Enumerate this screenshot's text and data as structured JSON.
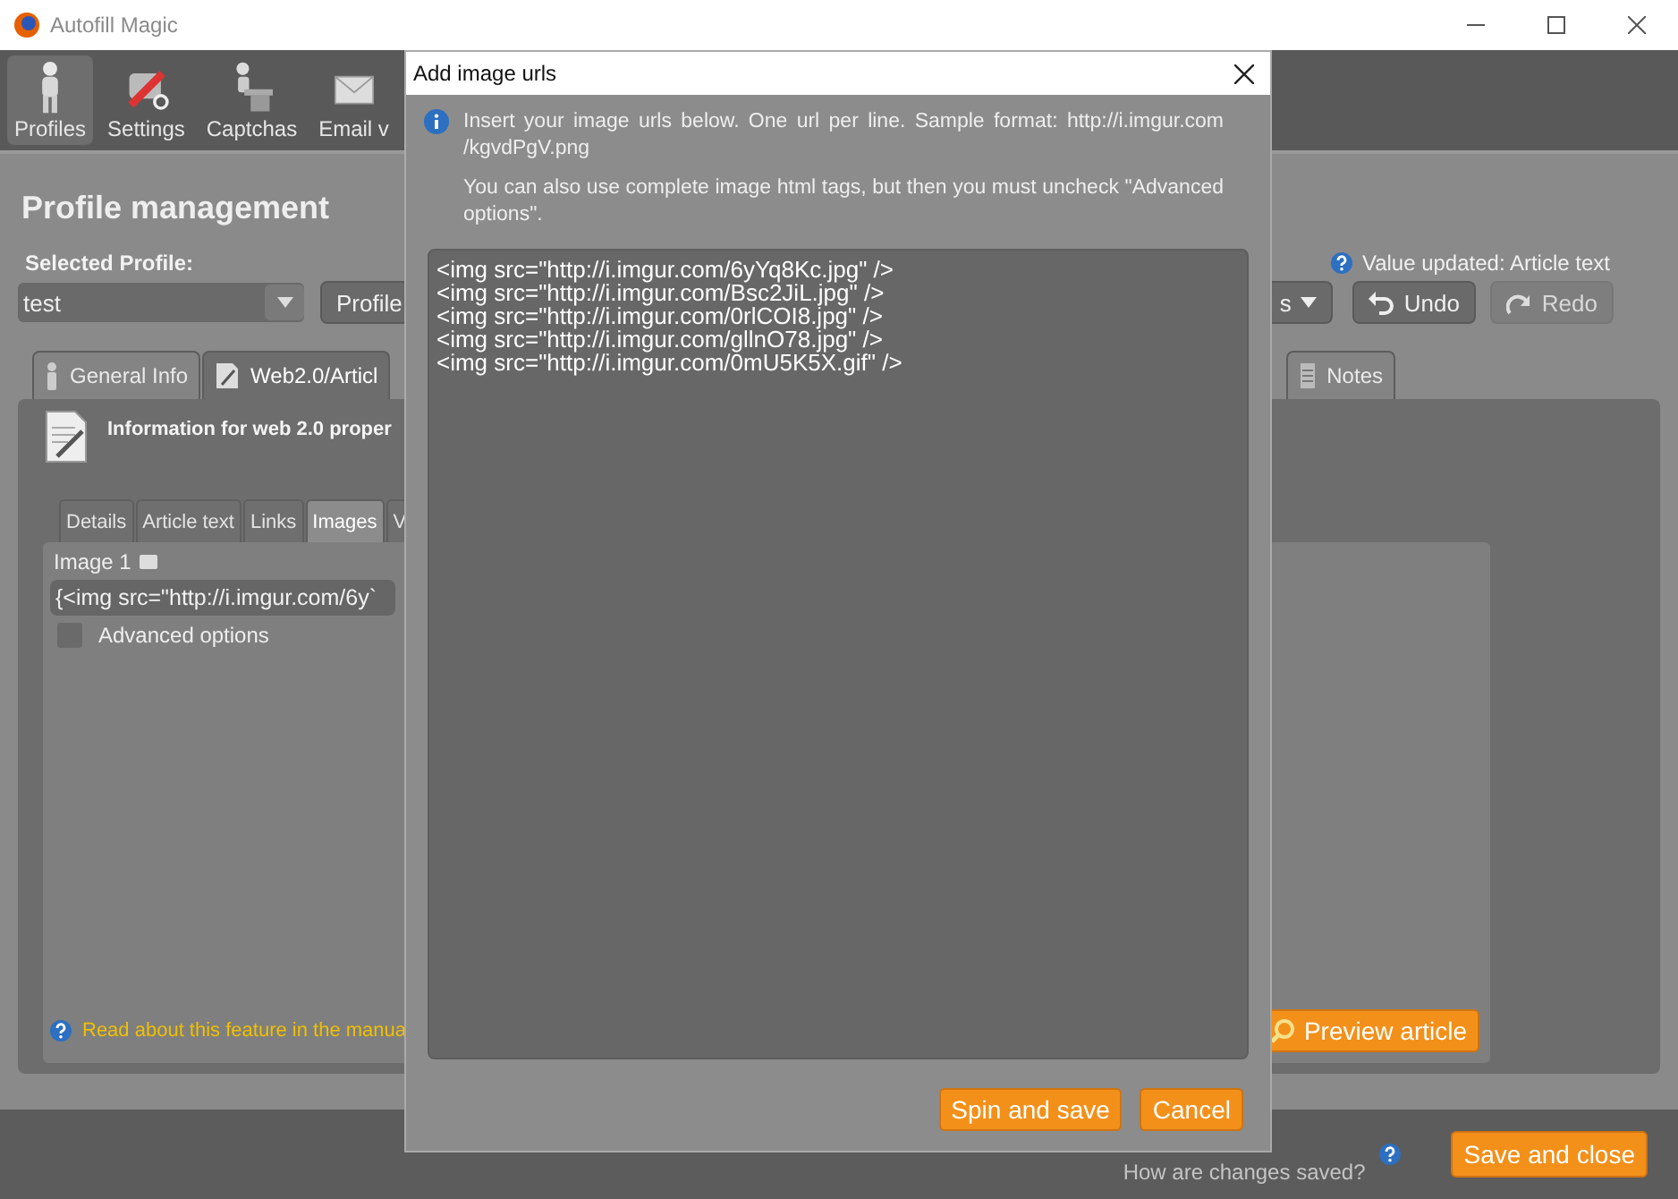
{
  "window": {
    "title": "Autofill Magic"
  },
  "toolbar": [
    {
      "label": "Profiles",
      "selected": true,
      "kind": "person"
    },
    {
      "label": "Settings",
      "selected": false,
      "kind": "tools"
    },
    {
      "label": "Captchas",
      "selected": false,
      "kind": "desk"
    },
    {
      "label": "Email v",
      "selected": false,
      "kind": "mail"
    }
  ],
  "page": {
    "heading": "Profile management",
    "profile_label": "Selected Profile:",
    "profile_value": "test",
    "profile_button": "Profile",
    "status": "Value updated: Article text",
    "menu_button": "s",
    "undo": {
      "label": "Undo",
      "disabled": false
    },
    "redo": {
      "label": "Redo",
      "disabled": true
    }
  },
  "tabs": [
    {
      "label": "General Info",
      "selected": false,
      "kind": "person"
    },
    {
      "label": "Web2.0/Articl",
      "selected": true,
      "kind": "doc"
    },
    {
      "label": "Notes",
      "selected": false,
      "kind": "notes"
    }
  ],
  "panel": {
    "heading": "Information for web 2.0 proper",
    "subtabs": [
      {
        "label": "Details",
        "selected": false
      },
      {
        "label": "Article text",
        "selected": false
      },
      {
        "label": "Links",
        "selected": false
      },
      {
        "label": "Images",
        "selected": true
      },
      {
        "label": "V",
        "selected": false
      }
    ],
    "image_label": "Image 1",
    "image_value": "{<img src=\"http://i.imgur.com/6y`",
    "advanced": {
      "label": "Advanced options",
      "checked": false
    },
    "help_link": "Read about this feature in the manua",
    "preview_button": "Preview article"
  },
  "footer": {
    "help_text": "How are changes saved?",
    "save_button": "Save and close"
  },
  "dialog": {
    "title": "Add image urls",
    "info": [
      "Insert your image urls below. One url per line. Sample format: http://i.imgur.com /kgvdPgV.png",
      "You can also use complete image html tags, but then you must uncheck \"Advanced options\"."
    ],
    "lines": [
      "<img src=\"http://i.imgur.com/6yYq8Kc.jpg\" />",
      "<img src=\"http://i.imgur.com/Bsc2JiL.jpg\" />",
      "<img src=\"http://i.imgur.com/0rlCOI8.jpg\" />",
      "<img src=\"http://i.imgur.com/gllnO78.jpg\" />",
      "<img src=\"http://i.imgur.com/0mU5K5X.gif\" />"
    ],
    "buttons": [
      "Spin and save",
      "Cancel"
    ]
  }
}
